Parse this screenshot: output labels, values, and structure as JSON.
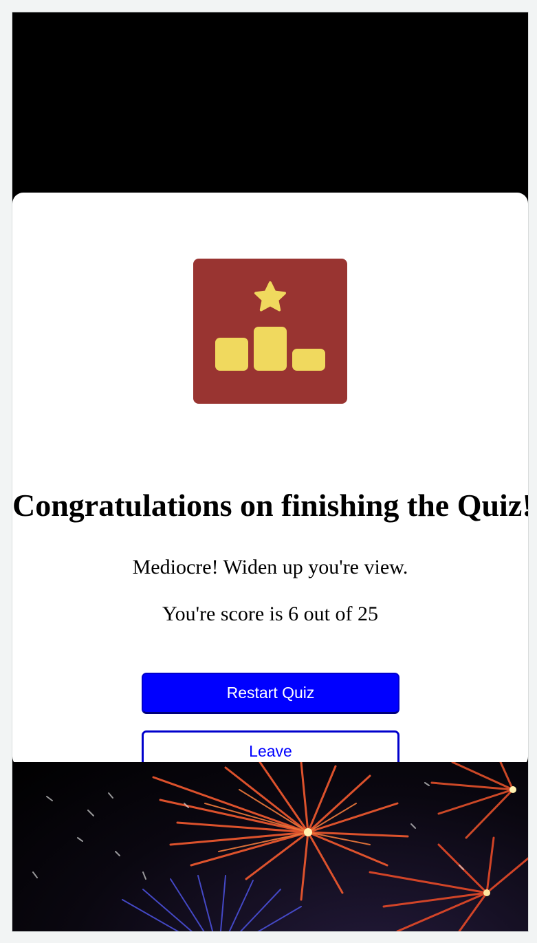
{
  "result": {
    "title": "Congratulations on finishing the Quiz!",
    "remark": "Mediocre! Widen up you're view.",
    "score_text": "You're score is 6 out of 25"
  },
  "actions": {
    "restart_label": "Restart Quiz",
    "leave_label": "Leave"
  },
  "icons": {
    "trophy": "podium-star-icon"
  },
  "colors": {
    "icon_background": "#993431",
    "icon_foreground": "#f0d95e",
    "primary_button": "#0000ff",
    "outline_button_border": "#0000cc"
  }
}
